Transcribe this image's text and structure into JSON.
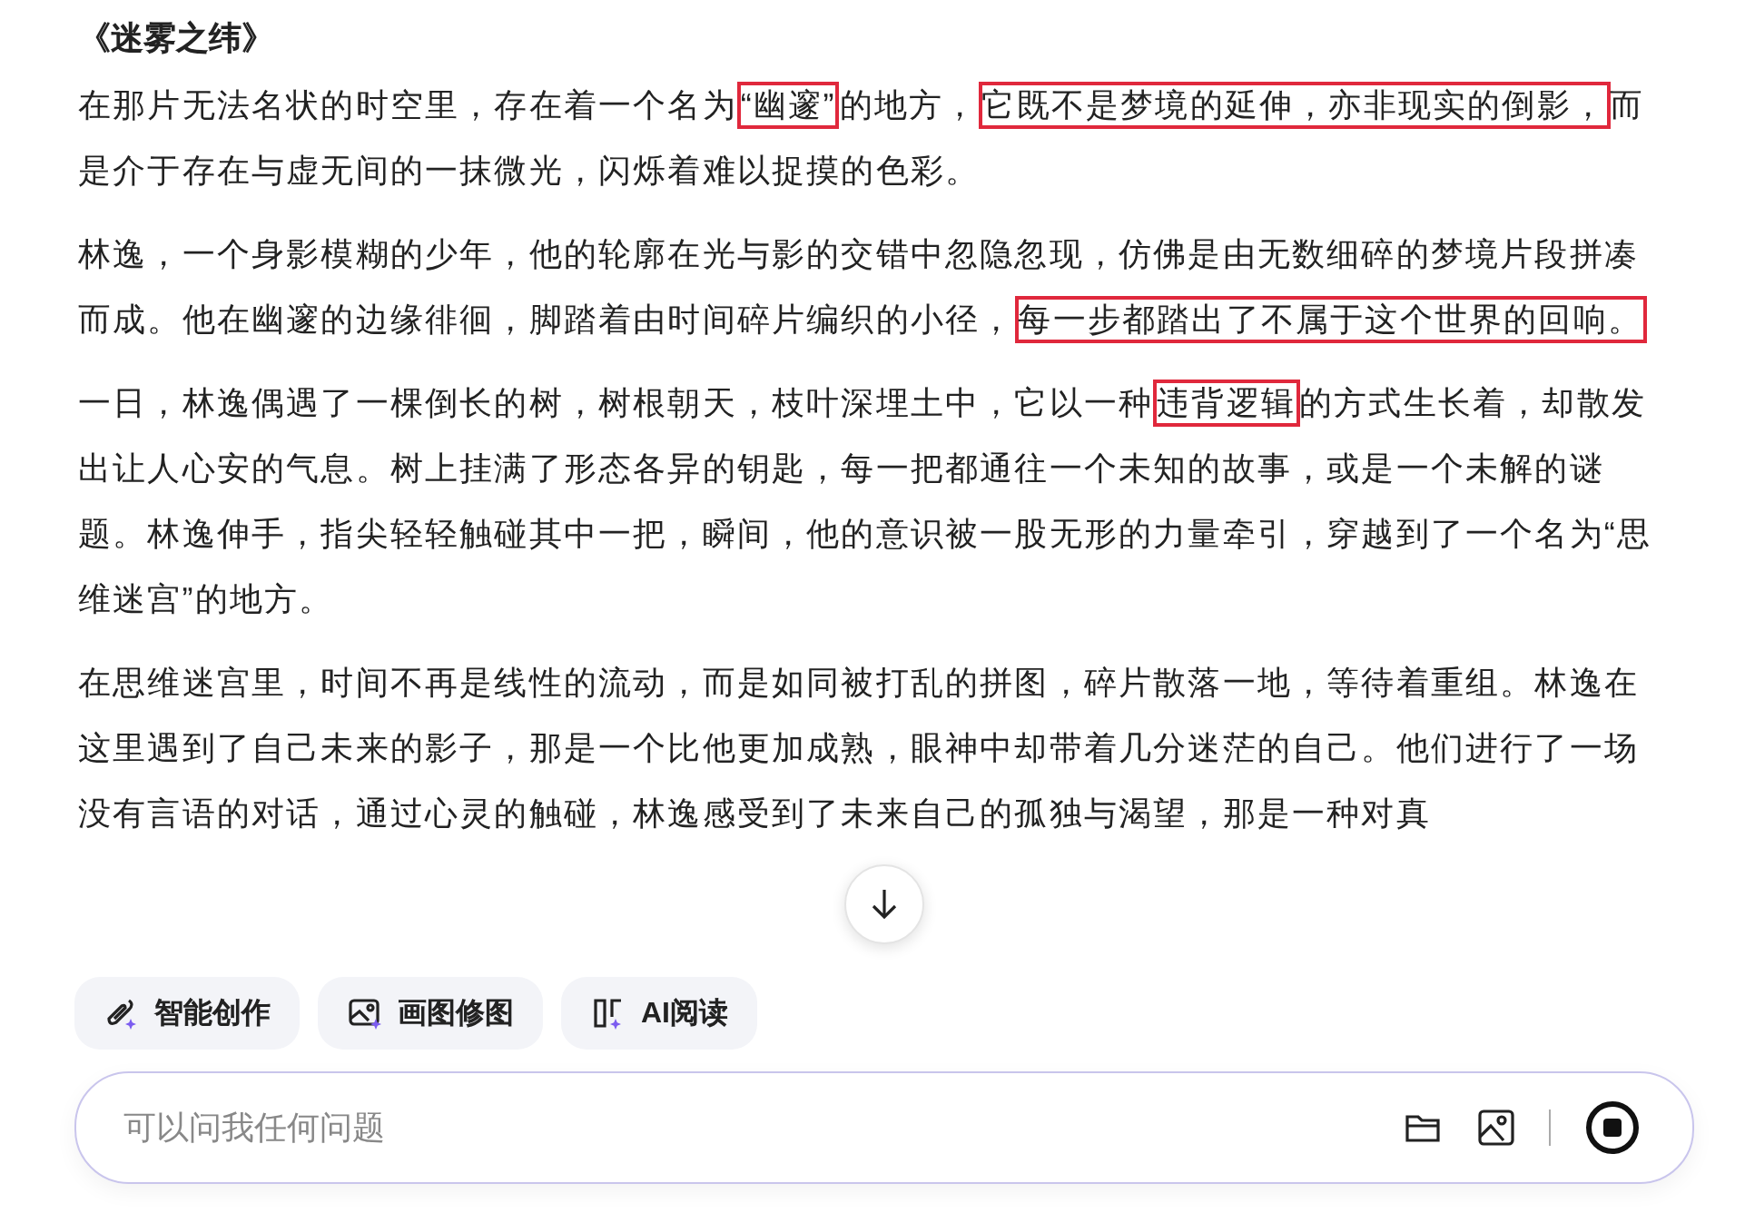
{
  "article": {
    "title": "《迷雾之纬》",
    "paragraphs": [
      {
        "segments": [
          {
            "text": "在那片无法名状的时空里，存在着一个名为",
            "boxed": false
          },
          {
            "text": "“幽邃”",
            "boxed": true
          },
          {
            "text": "的地方，",
            "boxed": false
          },
          {
            "text": "它既不是梦境的延伸，亦非现实的倒影，",
            "boxed": true
          },
          {
            "text": "而是介于存在与虚无间的一抹微光，闪烁着难以捉摸的色彩。",
            "boxed": false
          }
        ]
      },
      {
        "segments": [
          {
            "text": "林逸，一个身影模糊的少年，他的轮廓在光与影的交错中忽隐忽现，仿佛是由无数细碎的梦境片段拼凑而成。他在幽邃的边缘徘徊，脚踏着由时间碎片编织的小径，",
            "boxed": false
          },
          {
            "text": "每一步都踏出了不属于这个世界的回响。",
            "boxed": true
          }
        ]
      },
      {
        "segments": [
          {
            "text": "一日，林逸偶遇了一棵倒长的树，树根朝天，枝叶深埋土中，它以一种",
            "boxed": false
          },
          {
            "text": "违背逻辑",
            "boxed": true
          },
          {
            "text": "的方式生长着，却散发出让人心安的气息。树上挂满了形态各异的钥匙，每一把都通往一个未知的故事，或是一个未解的谜题。林逸伸手，指尖轻轻触碰其中一把，瞬间，他的意识被一股无形的力量牵引，穿越到了一个名为“思维迷宫”的地方。",
            "boxed": false
          }
        ]
      },
      {
        "segments": [
          {
            "text": "在思维迷宫里，时间不再是线性的流动，而是如同被打乱的拼图，碎片散落一地，等待着重组。林逸在这里遇到了自己未来的影子，那是一个比他更加成熟，眼神中却带着几分迷茫的自己。他们进行了一场没有言语的对话，通过心灵的触碰，林逸感受到了未来自己的孤独与渴望，那是一种对真",
            "boxed": false
          }
        ]
      }
    ]
  },
  "actions": [
    {
      "label": "智能创作",
      "kind": "write"
    },
    {
      "label": "画图修图",
      "kind": "image"
    },
    {
      "label": "AI阅读",
      "kind": "read"
    }
  ],
  "input": {
    "placeholder": "可以问我任何问题"
  }
}
